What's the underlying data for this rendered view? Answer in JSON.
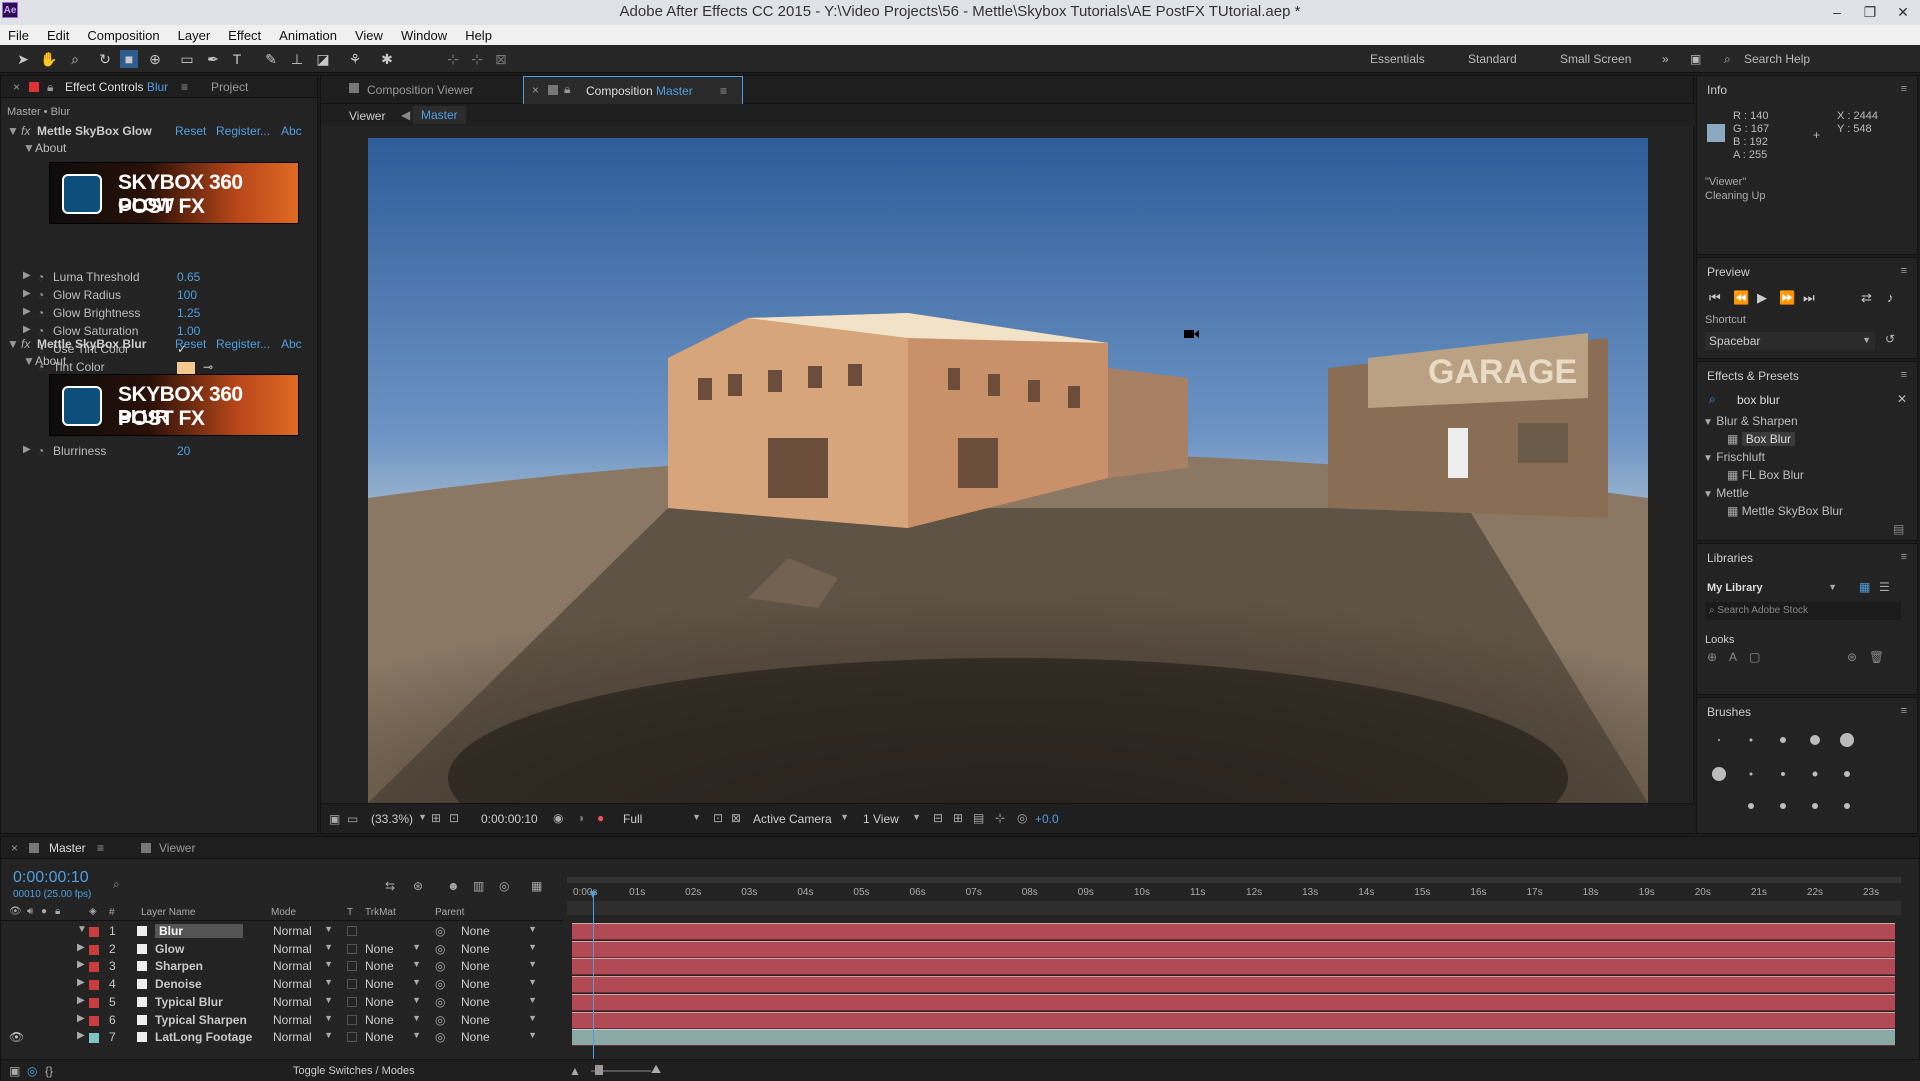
{
  "window": {
    "title": "Adobe After Effects CC 2015 - Y:\\Video Projects\\56 - Mettle\\Skybox Tutorials\\AE PostFX TUtorial.aep *",
    "logo": "Ae"
  },
  "menu": [
    "File",
    "Edit",
    "Composition",
    "Layer",
    "Effect",
    "Animation",
    "View",
    "Window",
    "Help"
  ],
  "workspaces": {
    "essentials": "Essentials",
    "standard": "Standard",
    "small_screen": "Small Screen",
    "search_help": "Search Help"
  },
  "effect_controls": {
    "tab_label": "Effect Controls",
    "tab_layer": "Blur",
    "project_tab": "Project",
    "breadcrumb": "Master • Blur",
    "effects": [
      {
        "name": "Mettle SkyBox Glow",
        "reset": "Reset",
        "register": "Register...",
        "abc": "Abc",
        "about": "About",
        "banner_title": "SKYBOX 360 POST FX",
        "banner_sub": "GLOW",
        "params": [
          {
            "label": "Luma Threshold",
            "value": "0.65"
          },
          {
            "label": "Glow Radius",
            "value": "100"
          },
          {
            "label": "Glow Brightness",
            "value": "1.25"
          },
          {
            "label": "Glow Saturation",
            "value": "1.00"
          },
          {
            "label": "Use Tint Color",
            "value": "✓"
          },
          {
            "label": "Tint Color",
            "value": ""
          }
        ],
        "tint_color": "#f2c98e"
      },
      {
        "name": "Mettle SkyBox Blur",
        "reset": "Reset",
        "register": "Register...",
        "abc": "Abc",
        "about": "About",
        "banner_title": "SKYBOX 360 POST FX",
        "banner_sub": "BLUR",
        "params": [
          {
            "label": "Blurriness",
            "value": "20"
          }
        ]
      }
    ]
  },
  "comp_tabs": {
    "viewer": "Composition Viewer",
    "comp_label": "Composition",
    "comp_name": "Master",
    "sub_viewer": "Viewer",
    "sub_master": "Master"
  },
  "viewer_bar": {
    "zoom": "(33.3%)",
    "timecode": "0:00:00:10",
    "resolution": "Full",
    "camera": "Active Camera",
    "views": "1 View",
    "exposure": "+0.0"
  },
  "info": {
    "title": "Info",
    "r": "R : 140",
    "g": "G : 167",
    "b": "B : 192",
    "a": "A : 255",
    "x": "X : 2444",
    "y": "Y : 548",
    "swatch": "#8ca7c0",
    "status1": "\"Viewer\"",
    "status2": "Cleaning Up"
  },
  "preview": {
    "title": "Preview",
    "shortcut_label": "Shortcut",
    "shortcut": "Spacebar"
  },
  "effects_presets": {
    "title": "Effects & Presets",
    "search": "box blur",
    "groups": [
      {
        "name": "Blur & Sharpen",
        "items": [
          "Box Blur"
        ]
      },
      {
        "name": "Frischluft",
        "items": [
          "FL Box Blur"
        ]
      },
      {
        "name": "Mettle",
        "items": [
          "Mettle SkyBox Blur"
        ]
      }
    ]
  },
  "libraries": {
    "title": "Libraries",
    "library": "My Library",
    "search_placeholder": "Search Adobe Stock",
    "looks": "Looks"
  },
  "brushes": {
    "title": "Brushes"
  },
  "timeline": {
    "tab": "Master",
    "viewer_tab": "Viewer",
    "timecode": "0:00:00:10",
    "fps": "00010 (25.00 fps)",
    "headers": {
      "layer_name": "Layer Name",
      "mode": "Mode",
      "t": "T",
      "trkmat": "TrkMat",
      "parent": "Parent",
      "num": "#"
    },
    "layers": [
      {
        "num": "1",
        "name": "Blur",
        "mode": "Normal",
        "trkmat": "",
        "parent": "None",
        "color": "#c83c3c"
      },
      {
        "num": "2",
        "name": "Glow",
        "mode": "Normal",
        "trkmat": "None",
        "parent": "None",
        "color": "#c83c3c"
      },
      {
        "num": "3",
        "name": "Sharpen",
        "mode": "Normal",
        "trkmat": "None",
        "parent": "None",
        "color": "#c83c3c"
      },
      {
        "num": "4",
        "name": "Denoise",
        "mode": "Normal",
        "trkmat": "None",
        "parent": "None",
        "color": "#c83c3c"
      },
      {
        "num": "5",
        "name": "Typical Blur",
        "mode": "Normal",
        "trkmat": "None",
        "parent": "None",
        "color": "#c83c3c"
      },
      {
        "num": "6",
        "name": "Typical Sharpen",
        "mode": "Normal",
        "trkmat": "None",
        "parent": "None",
        "color": "#c83c3c"
      },
      {
        "num": "7",
        "name": "LatLong Footage",
        "mode": "Normal",
        "trkmat": "None",
        "parent": "None",
        "color": "#7fc2c2"
      }
    ],
    "ruler": [
      "0:00s",
      "01s",
      "02s",
      "03s",
      "04s",
      "05s",
      "06s",
      "07s",
      "08s",
      "09s",
      "10s",
      "11s",
      "12s",
      "13s",
      "14s",
      "15s",
      "16s",
      "17s",
      "18s",
      "19s",
      "20s",
      "21s",
      "22s",
      "23s"
    ],
    "toggle": "Toggle Switches / Modes"
  }
}
